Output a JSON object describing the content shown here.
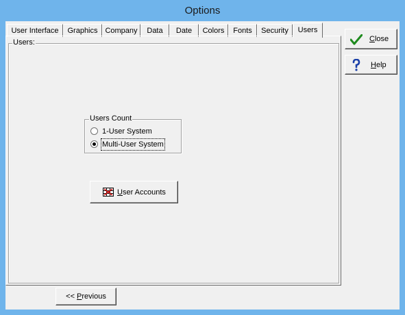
{
  "window": {
    "title": "Options"
  },
  "tabs": [
    {
      "label": "User Interface"
    },
    {
      "label": "Graphics"
    },
    {
      "label": "Company"
    },
    {
      "label": "Data"
    },
    {
      "label": "Date"
    },
    {
      "label": "Colors"
    },
    {
      "label": "Fonts"
    },
    {
      "label": "Security"
    },
    {
      "label": "Users",
      "active": true
    }
  ],
  "users_group": {
    "legend": "Users:"
  },
  "users_count": {
    "legend": "Users Count",
    "options": [
      {
        "label": "1-User System",
        "checked": false
      },
      {
        "label": "Multi-User System",
        "checked": true
      }
    ]
  },
  "buttons": {
    "user_accounts": {
      "mnemonic": "U",
      "rest": "ser Accounts"
    },
    "close": {
      "mnemonic": "C",
      "rest": "lose"
    },
    "help": {
      "mnemonic": "H",
      "rest": "elp"
    },
    "previous": {
      "prefix": "<< ",
      "mnemonic": "P",
      "rest": "revious"
    }
  },
  "icons": {
    "close": "checkmark-icon",
    "help": "question-mark-icon",
    "user_accounts": "user-accounts-icon"
  },
  "colors": {
    "title_bar": "#6fb4eb",
    "client_bg": "#f0f0f0",
    "check_green": "#1e8a1e",
    "help_blue": "#1a3fa8"
  }
}
